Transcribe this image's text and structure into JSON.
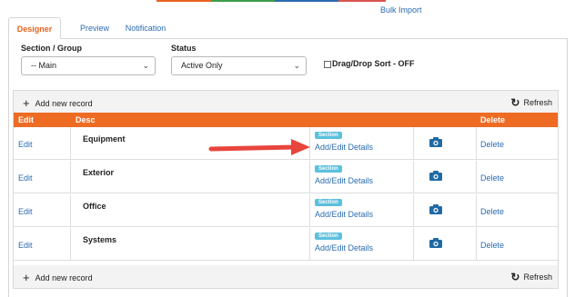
{
  "header": {
    "bulk_import": "Bulk Import",
    "top_line_colors": [
      "#e8631f",
      "#3c9c4a",
      "#2b6cb0",
      "#d9534f"
    ]
  },
  "tabs": [
    {
      "label": "Designer",
      "active": true
    },
    {
      "label": "Preview",
      "active": false
    },
    {
      "label": "Notification",
      "active": false
    }
  ],
  "filters": {
    "section_label": "Section / Group",
    "section_value": "-- Main",
    "status_label": "Status",
    "status_value": "Active Only",
    "dragdrop_label": "Drag/Drop Sort - OFF",
    "dragdrop_checked": false
  },
  "toolbar": {
    "add_label": "Add new record",
    "add_icon": "plus-icon",
    "refresh_label": "Refresh",
    "refresh_icon": "refresh-icon"
  },
  "table": {
    "columns": {
      "edit": "Edit",
      "desc": "Desc",
      "delete": "Delete"
    },
    "rows": [
      {
        "edit": "Edit",
        "desc": "Equipment",
        "badge": "Section",
        "details": "Add/Edit Details",
        "delete": "Delete"
      },
      {
        "edit": "Edit",
        "desc": "Exterior",
        "badge": "Section",
        "details": "Add/Edit Details",
        "delete": "Delete"
      },
      {
        "edit": "Edit",
        "desc": "Office",
        "badge": "Section",
        "details": "Add/Edit Details",
        "delete": "Delete"
      },
      {
        "edit": "Edit",
        "desc": "Systems",
        "badge": "Section",
        "details": "Add/Edit Details",
        "delete": "Delete"
      }
    ]
  },
  "annotation": {
    "arrow_color": "#e8453c"
  },
  "colors": {
    "accent": "#ee6b24",
    "link": "#2b6cb0",
    "badge": "#5bc0de",
    "camera": "#1f6aa5"
  }
}
